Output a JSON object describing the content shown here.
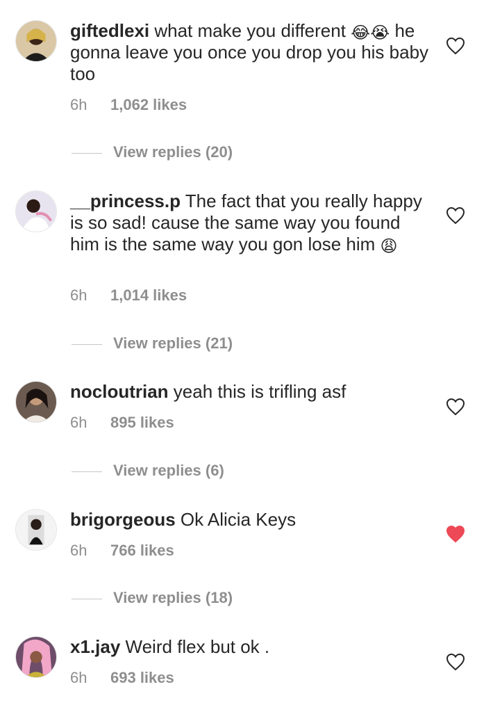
{
  "comments": [
    {
      "username": "giftedlexi",
      "text": " what make you different ",
      "emoji_1": "😂",
      "emoji_2": "😭",
      "text_2": " he gonna leave you once you drop you his baby too",
      "time": "6h",
      "likes": "1,062 likes",
      "replies": "View replies (20)",
      "liked": false
    },
    {
      "username": "__princess.p",
      "text": " The fact that you really happy is so sad! cause the same way you found him is the same way you gon lose him ",
      "emoji_1": "😩",
      "time": "6h",
      "likes": "1,014 likes",
      "replies": "View replies (21)",
      "liked": false
    },
    {
      "username": "nocloutrian",
      "text": " yeah this is trifling asf",
      "time": "6h",
      "likes": "895 likes",
      "replies": "View replies (6)",
      "liked": false
    },
    {
      "username": "brigorgeous",
      "text": " Ok Alicia Keys",
      "time": "6h",
      "likes": "766 likes",
      "replies": "View replies (18)",
      "liked": true
    },
    {
      "username": "x1.jay",
      "text": " Weird flex but ok .",
      "time": "6h",
      "likes": "693 likes",
      "liked": false
    }
  ],
  "colors": {
    "text": "#262626",
    "muted": "#8e8e8e",
    "liked_heart": "#ed4956",
    "outline_heart": "#262626"
  },
  "icons": {
    "like": "heart-outline-icon",
    "liked": "heart-filled-icon"
  }
}
